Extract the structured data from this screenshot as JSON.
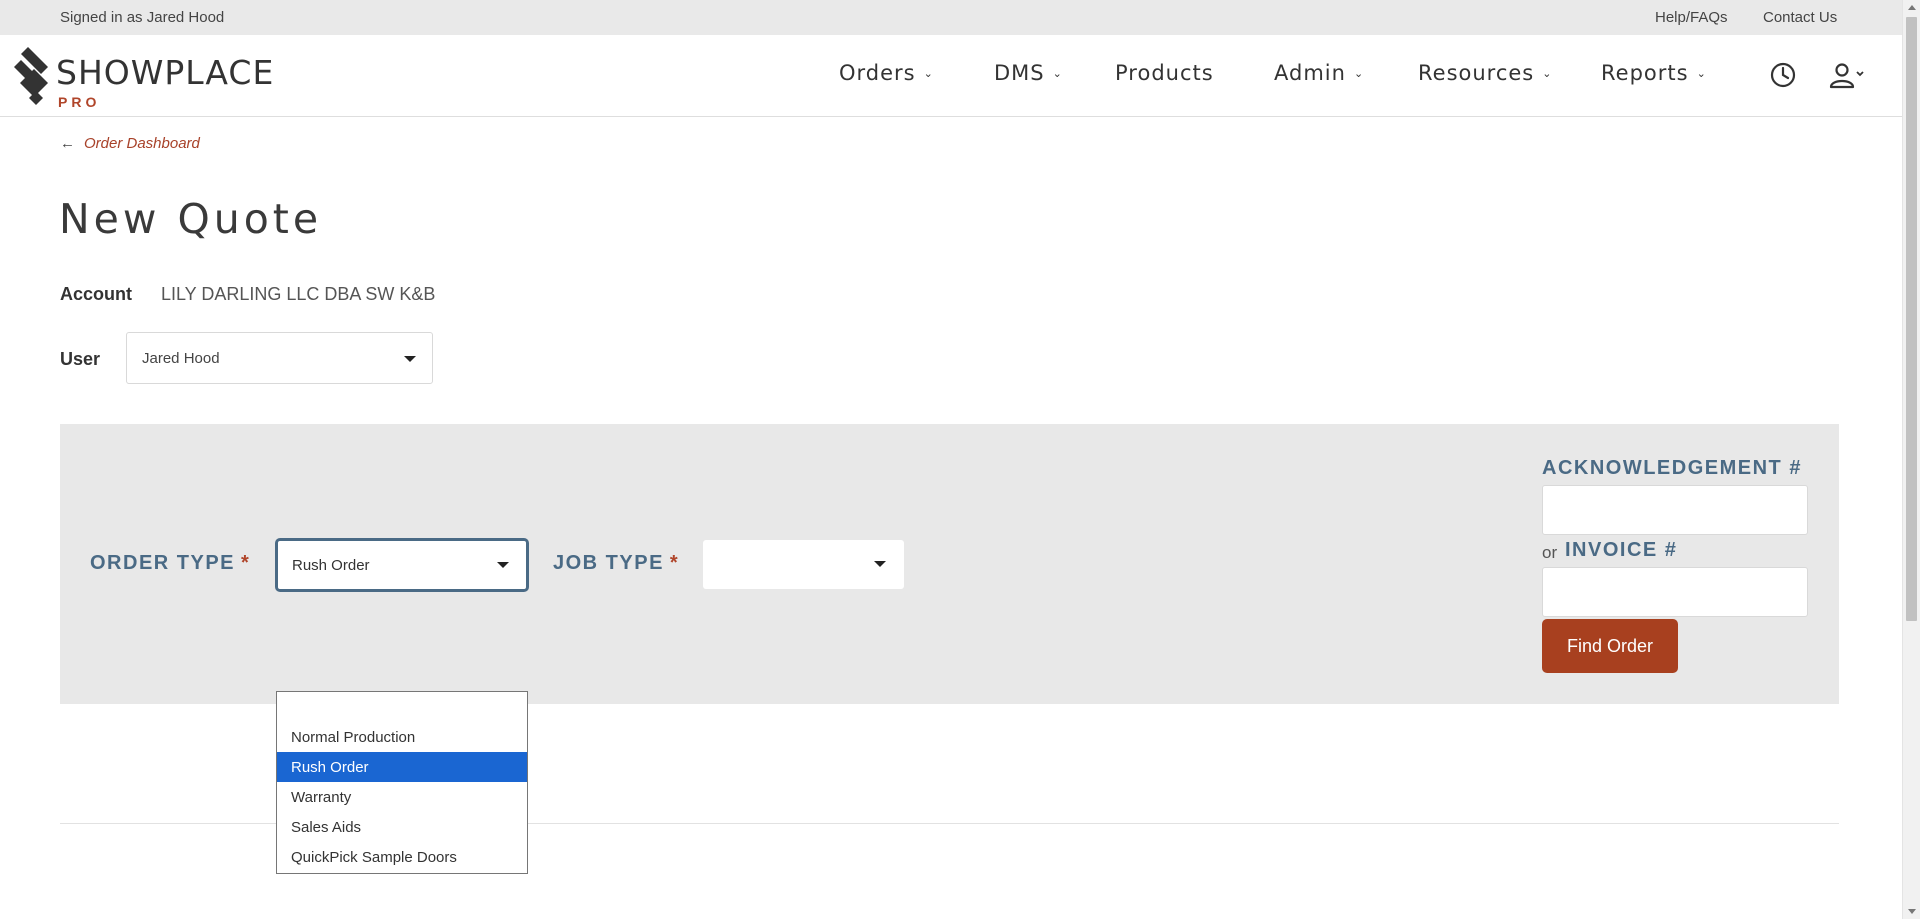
{
  "topbar": {
    "signed_in": "Signed in as Jared Hood",
    "help": "Help/FAQs",
    "contact": "Contact Us"
  },
  "logo": {
    "word": "SHOWPLACE",
    "sub": "PRO"
  },
  "nav": {
    "items": [
      {
        "label": "Orders",
        "dropdown": true
      },
      {
        "label": "DMS",
        "dropdown": true
      },
      {
        "label": "Products",
        "dropdown": false
      },
      {
        "label": "Admin",
        "dropdown": true
      },
      {
        "label": "Resources",
        "dropdown": true
      },
      {
        "label": "Reports",
        "dropdown": true
      }
    ],
    "icons": [
      "clock-icon",
      "user-icon"
    ]
  },
  "breadcrumb": {
    "label": "Order Dashboard"
  },
  "page": {
    "title": "New Quote"
  },
  "account": {
    "label": "Account",
    "value": "LILY DARLING LLC DBA SW K&B"
  },
  "user": {
    "label": "User",
    "value": "Jared Hood"
  },
  "form": {
    "order_type_label": "ORDER TYPE",
    "job_type_label": "JOB TYPE",
    "required_mark": "*",
    "order_type_value": "Rush Order",
    "job_type_value": "",
    "ack_label": "ACKNOWLEDGEMENT #",
    "or_text": "or",
    "invoice_label": "INVOICE #",
    "find_button": "Find Order"
  },
  "order_type_options": {
    "items": [
      "",
      "Normal Production",
      "Rush Order",
      "Warranty",
      "Sales Aids",
      "QuickPick Sample Doors"
    ],
    "selected_index": 2
  },
  "colors": {
    "accent": "#a8401f",
    "label_blue": "#4a6a85",
    "panel_bg": "#e8e8e8",
    "selection": "#1a66d2"
  }
}
